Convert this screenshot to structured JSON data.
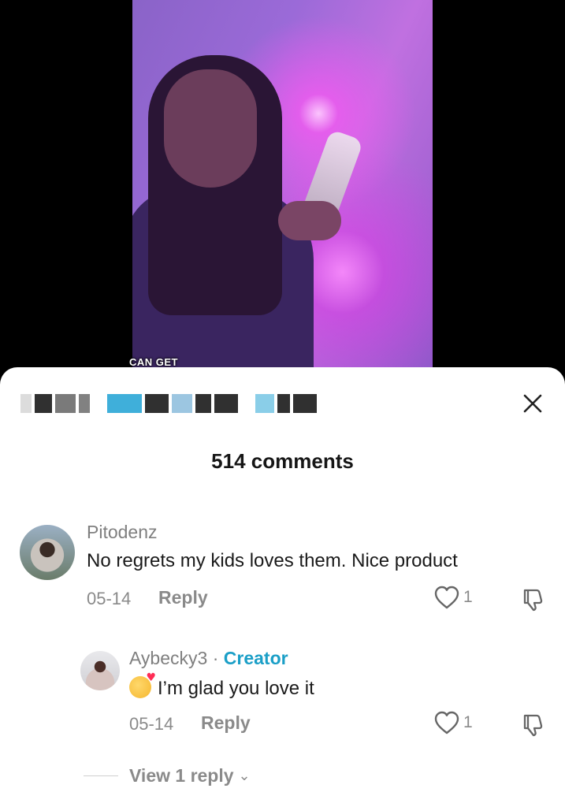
{
  "video": {
    "caption_peek": "CAN GET JUST"
  },
  "sheet": {
    "header_pixel_colors": [
      "#bfbfbf",
      "#1a1a1a",
      "#6c6c6c",
      "#1a1a1a",
      "#2aa6d6",
      "#1a1a1a",
      "#4a98c8",
      "#1a1a1a",
      "#1a1a1a",
      "#2aa6d6",
      "#1a1a1a",
      "#1a1a1a"
    ],
    "comments_count": "514 comments",
    "close_icon": "close-icon"
  },
  "comments": [
    {
      "username": "Pitodenz",
      "text": "No regrets my kids loves them. Nice product",
      "date": "05-14",
      "reply_label": "Reply",
      "likes": "1",
      "replies": [
        {
          "username": "Aybecky3",
          "separator": " · ",
          "creator_label": "Creator",
          "emoji": "smiling-face-with-hearts",
          "text": "I’m glad you love it",
          "date": "05-14",
          "reply_label": "Reply",
          "likes": "1"
        }
      ],
      "view_replies_label": "View 1 reply"
    }
  ]
}
